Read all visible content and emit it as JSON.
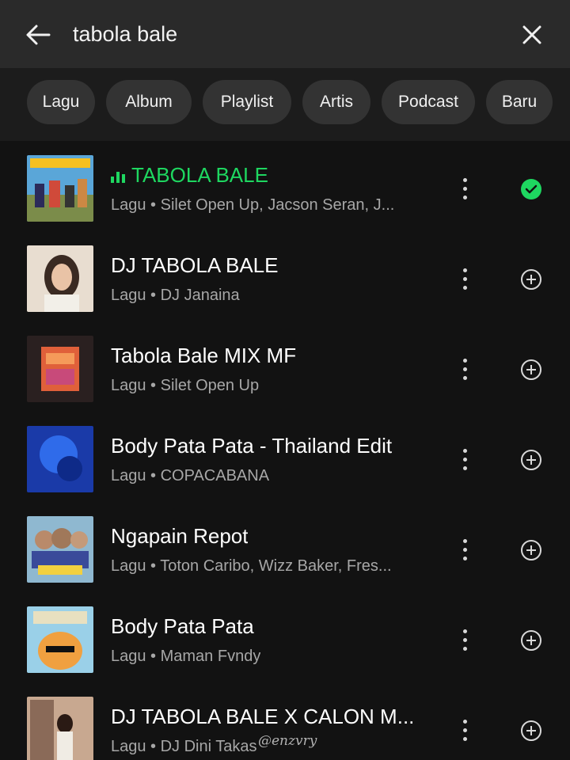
{
  "search": {
    "query": "tabola bale"
  },
  "filters": [
    "Lagu",
    "Album",
    "Playlist",
    "Artis",
    "Podcast",
    "Baru"
  ],
  "results": [
    {
      "title": "TABOLA BALE",
      "subtitle": "Lagu • Silet Open Up, Jacson Seran, J...",
      "playing": true,
      "added": true
    },
    {
      "title": "DJ TABOLA BALE",
      "subtitle": "Lagu • DJ Janaina",
      "playing": false,
      "added": false
    },
    {
      "title": "Tabola Bale MIX MF",
      "subtitle": "Lagu • Silet Open Up",
      "playing": false,
      "added": false
    },
    {
      "title": "Body Pata Pata - Thailand Edit",
      "subtitle": "Lagu • COPACABANA",
      "playing": false,
      "added": false
    },
    {
      "title": "Ngapain Repot",
      "subtitle": "Lagu • Toton Caribo, Wizz Baker, Fres...",
      "playing": false,
      "added": false
    },
    {
      "title": "Body Pata Pata",
      "subtitle": "Lagu • Maman Fvndy",
      "playing": false,
      "added": false
    },
    {
      "title": "DJ TABOLA BALE X CALON M...",
      "subtitle": "Lagu • DJ Dini Takas",
      "playing": false,
      "added": false
    }
  ],
  "watermark": "@enzvry",
  "colors": {
    "accent": "#1ed760",
    "background": "#121212",
    "search_bar": "#2a2a2a",
    "chip": "#333333",
    "secondary_text": "#a7a7a7"
  }
}
